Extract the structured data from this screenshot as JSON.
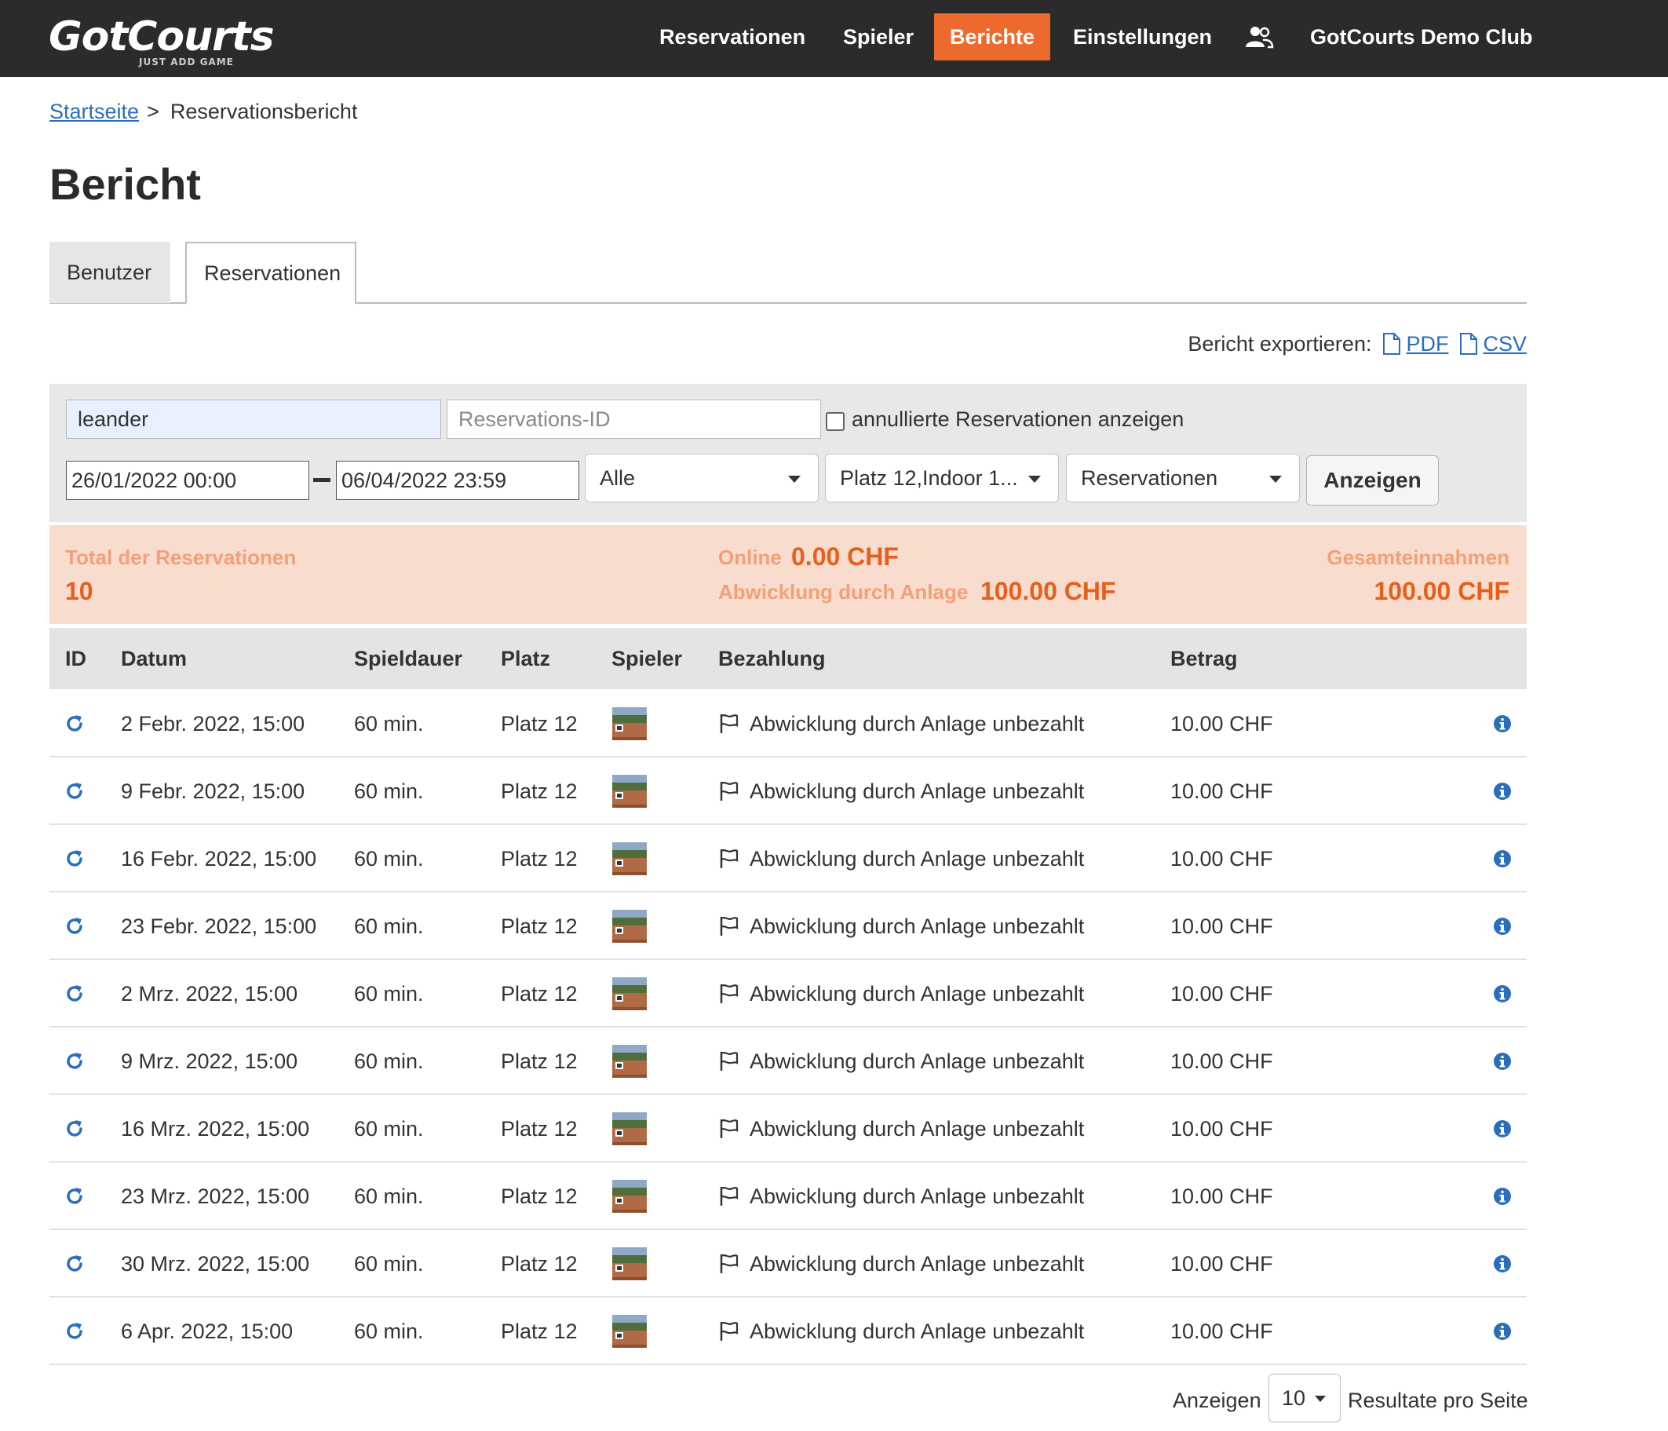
{
  "navbar": {
    "logo_main": "GotCourts",
    "logo_sub": "JUST ADD GAME",
    "items": [
      "Reservationen",
      "Spieler",
      "Berichte",
      "Einstellungen"
    ],
    "active_item": "Berichte",
    "club_name": "GotCourts Demo Club",
    "users_icon": "users-icon",
    "bg_color": "#2b2b2b",
    "accent_color": "#ec6a2c"
  },
  "breadcrumb": {
    "home": "Startseite",
    "separator": ">",
    "current": "Reservationsbericht"
  },
  "page_title": "Bericht",
  "tabs": [
    "Benutzer",
    "Reservationen"
  ],
  "selected_tab": "Reservationen",
  "export": {
    "label": "Bericht exportieren:",
    "pdf": "PDF",
    "csv": "CSV",
    "icon": "file-icon"
  },
  "filters": {
    "search_value": "leander",
    "reservation_id_placeholder": "Reservations-ID",
    "show_cancelled_label": "annullierte Reservationen anzeigen",
    "show_cancelled_checked": false,
    "date_from": "26/01/2022 00:00",
    "date_to": "06/04/2022 23:59",
    "type_select": "Alle",
    "court_select": "Platz 12,Indoor 1...",
    "report_select": "Reservationen",
    "submit_label": "Anzeigen"
  },
  "summary": {
    "total_label": "Total der Reservationen",
    "total_value": "10",
    "online_label": "Online",
    "online_value": "0.00 CHF",
    "facility_label": "Abwicklung durch Anlage",
    "facility_value": "100.00 CHF",
    "revenue_label": "Gesamteinnahmen",
    "revenue_value": "100.00 CHF"
  },
  "table": {
    "columns": [
      "ID",
      "Datum",
      "Spieldauer",
      "Platz",
      "Spieler",
      "Bezahlung",
      "Betrag"
    ],
    "rows": [
      {
        "date": "2 Febr. 2022, 15:00",
        "duration": "60 min.",
        "court": "Platz 12",
        "payment": "Abwicklung durch Anlage unbezahlt",
        "amount": "10.00 CHF"
      },
      {
        "date": "9 Febr. 2022, 15:00",
        "duration": "60 min.",
        "court": "Platz 12",
        "payment": "Abwicklung durch Anlage unbezahlt",
        "amount": "10.00 CHF"
      },
      {
        "date": "16 Febr. 2022, 15:00",
        "duration": "60 min.",
        "court": "Platz 12",
        "payment": "Abwicklung durch Anlage unbezahlt",
        "amount": "10.00 CHF"
      },
      {
        "date": "23 Febr. 2022, 15:00",
        "duration": "60 min.",
        "court": "Platz 12",
        "payment": "Abwicklung durch Anlage unbezahlt",
        "amount": "10.00 CHF"
      },
      {
        "date": "2 Mrz. 2022, 15:00",
        "duration": "60 min.",
        "court": "Platz 12",
        "payment": "Abwicklung durch Anlage unbezahlt",
        "amount": "10.00 CHF"
      },
      {
        "date": "9 Mrz. 2022, 15:00",
        "duration": "60 min.",
        "court": "Platz 12",
        "payment": "Abwicklung durch Anlage unbezahlt",
        "amount": "10.00 CHF"
      },
      {
        "date": "16 Mrz. 2022, 15:00",
        "duration": "60 min.",
        "court": "Platz 12",
        "payment": "Abwicklung durch Anlage unbezahlt",
        "amount": "10.00 CHF"
      },
      {
        "date": "23 Mrz. 2022, 15:00",
        "duration": "60 min.",
        "court": "Platz 12",
        "payment": "Abwicklung durch Anlage unbezahlt",
        "amount": "10.00 CHF"
      },
      {
        "date": "30 Mrz. 2022, 15:00",
        "duration": "60 min.",
        "court": "Platz 12",
        "payment": "Abwicklung durch Anlage unbezahlt",
        "amount": "10.00 CHF"
      },
      {
        "date": "6 Apr. 2022, 15:00",
        "duration": "60 min.",
        "court": "Platz 12",
        "payment": "Abwicklung durch Anlage unbezahlt",
        "amount": "10.00 CHF"
      }
    ],
    "row_icons": {
      "id": "repeat-icon",
      "player": "player-avatar",
      "payment": "flag-icon",
      "details": "info-icon"
    },
    "link_color": "#2a6ebb"
  },
  "pagination": {
    "prefix": "Anzeigen",
    "page_size": "10",
    "suffix": "Resultate pro Seite"
  }
}
